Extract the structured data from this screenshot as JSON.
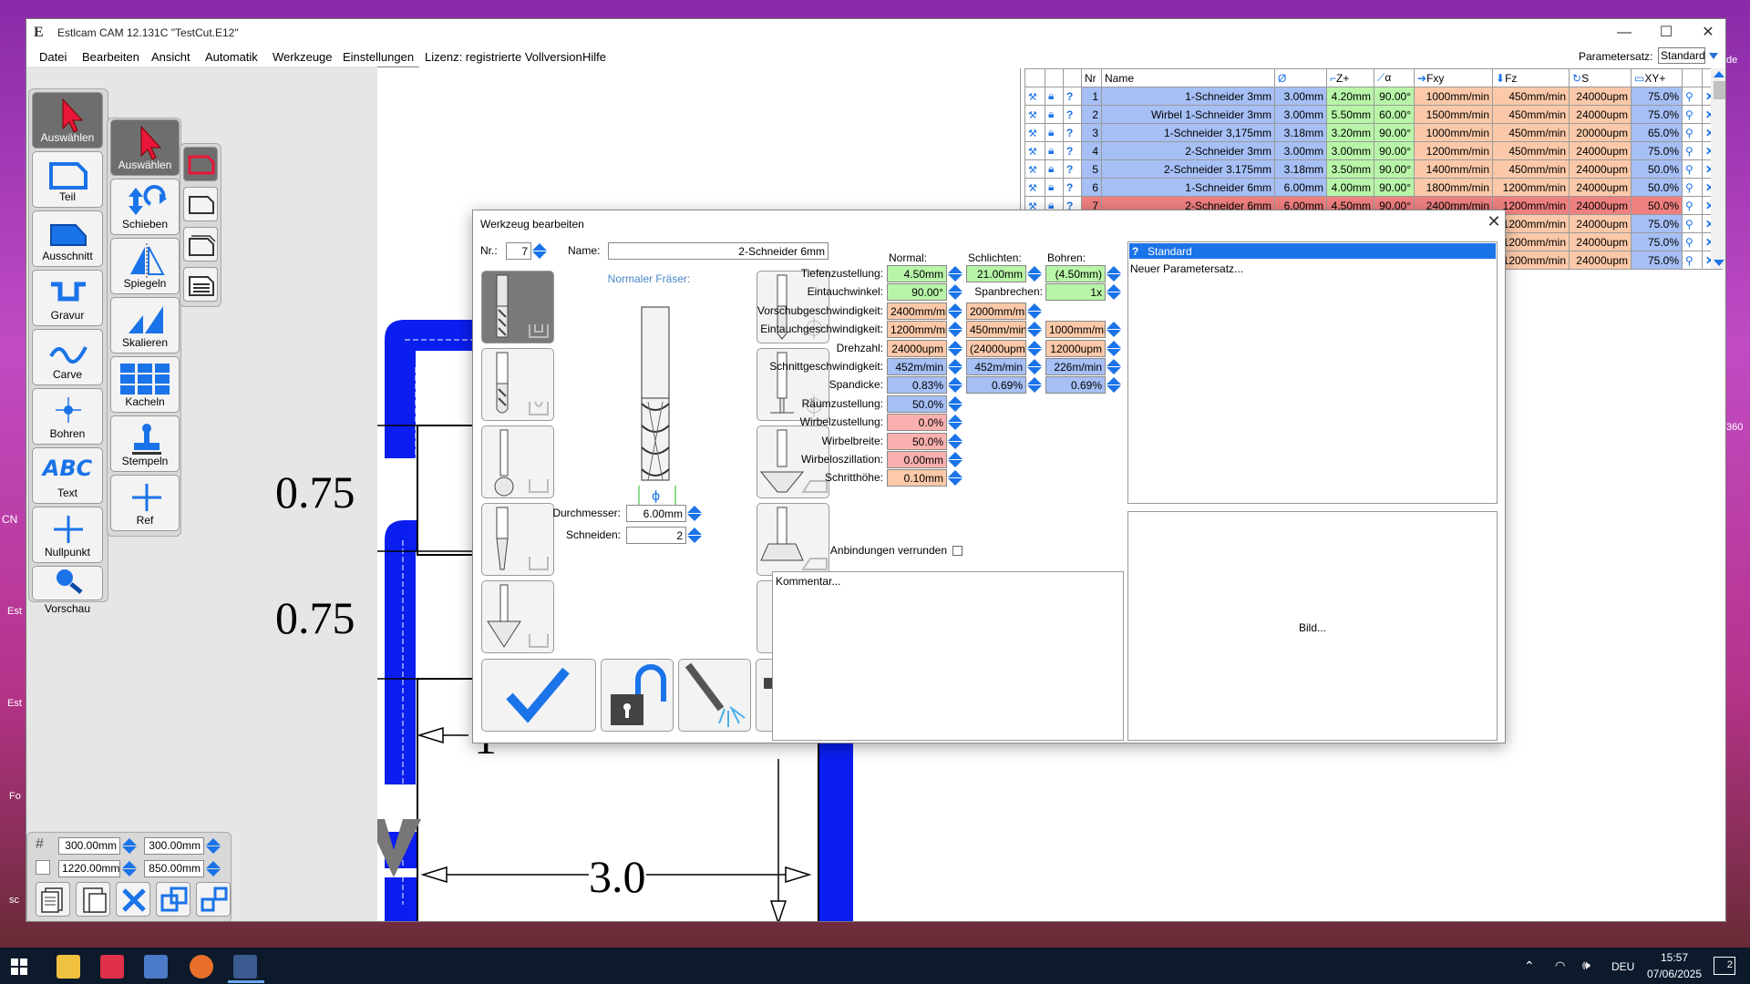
{
  "window": {
    "title": "Estlcam CAM 12.131C \"TestCut.E12\"",
    "minimize": "—",
    "maximize": "☐",
    "close": "✕"
  },
  "menu": [
    "Datei",
    "Bearbeiten",
    "Ansicht",
    "Automatik",
    "Werkzeuge",
    "Einstellungen",
    "Lizenz: registrierte Vollversion",
    "Hilfe"
  ],
  "paramset": {
    "label": "Parametersatz:",
    "value": "Standard"
  },
  "tools_left": [
    {
      "label": "Auswählen",
      "icon": "cursor-icon"
    },
    {
      "label": "Teil",
      "icon": "part-icon"
    },
    {
      "label": "Ausschnitt",
      "icon": "cutout-icon"
    },
    {
      "label": "Gravur",
      "icon": "engrave-icon"
    },
    {
      "label": "Carve",
      "icon": "carve-icon"
    },
    {
      "label": "Bohren",
      "icon": "drill-icon"
    },
    {
      "label": "Text",
      "icon": "text-icon",
      "glyph": "ABC"
    },
    {
      "label": "Nullpunkt",
      "icon": "origin-icon"
    },
    {
      "label": "Vorschau",
      "icon": "preview-icon"
    }
  ],
  "tools_mid": [
    {
      "label": "Auswählen",
      "icon": "cursor-icon"
    },
    {
      "label": "Schieben",
      "icon": "move-icon"
    },
    {
      "label": "Spiegeln",
      "icon": "mirror-icon"
    },
    {
      "label": "Skalieren",
      "icon": "scale-icon"
    },
    {
      "label": "Kacheln",
      "icon": "tile-icon"
    },
    {
      "label": "Stempeln",
      "icon": "stamp-icon"
    },
    {
      "label": "Ref",
      "icon": "ref-icon"
    }
  ],
  "size_fields": {
    "w1": "300.00mm",
    "h1": "300.00mm",
    "w2": "1220.00mm",
    "h2": "850.00mm"
  },
  "drawing": {
    "dim1": "0.75",
    "dim2": "0.75",
    "dim3": "3.0",
    "dim4": "1"
  },
  "tooltable": {
    "headers": [
      "Nr",
      "Name",
      "Ø",
      "Z+",
      "α",
      "Fxy",
      "Fz",
      "S",
      "XY+"
    ],
    "rows": [
      {
        "nr": "1",
        "name": "1-Schneider 3mm",
        "d": "3.00mm",
        "z": "4.20mm",
        "a": "90.00°",
        "fxy": "1000mm/min",
        "fz": "450mm/min",
        "s": "24000upm",
        "xy": "75.0%"
      },
      {
        "nr": "2",
        "name": "Wirbel 1-Schneider 3mm",
        "d": "3.00mm",
        "z": "5.50mm",
        "a": "60.00°",
        "fxy": "1500mm/min",
        "fz": "450mm/min",
        "s": "24000upm",
        "xy": "75.0%"
      },
      {
        "nr": "3",
        "name": "1-Schneider 3,175mm",
        "d": "3.18mm",
        "z": "3.20mm",
        "a": "90.00°",
        "fxy": "1000mm/min",
        "fz": "450mm/min",
        "s": "20000upm",
        "xy": "65.0%"
      },
      {
        "nr": "4",
        "name": "2-Schneider 3mm",
        "d": "3.00mm",
        "z": "3.00mm",
        "a": "90.00°",
        "fxy": "1200mm/min",
        "fz": "450mm/min",
        "s": "24000upm",
        "xy": "75.0%"
      },
      {
        "nr": "5",
        "name": "2-Schneider 3.175mm",
        "d": "3.18mm",
        "z": "3.50mm",
        "a": "90.00°",
        "fxy": "1400mm/min",
        "fz": "450mm/min",
        "s": "24000upm",
        "xy": "50.0%"
      },
      {
        "nr": "6",
        "name": "1-Schneider 6mm",
        "d": "6.00mm",
        "z": "4.00mm",
        "a": "90.00°",
        "fxy": "1800mm/min",
        "fz": "1200mm/min",
        "s": "24000upm",
        "xy": "50.0%"
      },
      {
        "nr": "7",
        "name": "2-Schneider 6mm",
        "d": "6.00mm",
        "z": "4.50mm",
        "a": "90.00°",
        "fxy": "2400mm/min",
        "fz": "1200mm/min",
        "s": "24000upm",
        "xy": "50.0%"
      },
      {
        "nr": "",
        "name": "",
        "d": "",
        "z": "",
        "a": "",
        "fxy": "",
        "fz": "1200mm/min",
        "s": "24000upm",
        "xy": "75.0%"
      },
      {
        "nr": "",
        "name": "",
        "d": "",
        "z": "",
        "a": "",
        "fxy": "",
        "fz": "1200mm/min",
        "s": "24000upm",
        "xy": "75.0%"
      },
      {
        "nr": "",
        "name": "",
        "d": "",
        "z": "",
        "a": "",
        "fxy": "",
        "fz": "1200mm/min",
        "s": "24000upm",
        "xy": "75.0%"
      }
    ]
  },
  "dialog": {
    "title": "Werkzeug bearbeiten",
    "nr_label": "Nr.:",
    "nr_value": "7",
    "name_label": "Name:",
    "name_value": "2-Schneider 6mm",
    "type_label": "Normaler Fräser:",
    "durchmesser_label": "Durchmesser:",
    "durchmesser_value": "6.00mm",
    "schneiden_label": "Schneiden:",
    "schneiden_value": "2",
    "col_normal": "Normal:",
    "col_schlichten": "Schlichten:",
    "col_bohren": "Bohren:",
    "params": [
      {
        "label": "Tiefenzustellung:",
        "normal": "4.50mm",
        "schlichten": "21.00mm",
        "bohren": "(4.50mm)"
      },
      {
        "label": "Eintauchwinkel:",
        "normal": "90.00°",
        "schlichten_label": "Spanbrechen:",
        "bohren": "1x"
      },
      {
        "label": "Vorschubgeschwindigkeit:",
        "normal": "2400mm/min",
        "schlichten": "2000mm/min"
      },
      {
        "label": "Eintauchgeschwindigkeit:",
        "normal": "1200mm/min",
        "schlichten": "450mm/min",
        "bohren": "1000mm/min"
      },
      {
        "label": "Drehzahl:",
        "normal": "24000upm",
        "schlichten": "(24000upm)",
        "bohren": "12000upm"
      },
      {
        "label": "Schnittgeschwindigkeit:",
        "normal": "452m/min",
        "schlichten": "452m/min",
        "bohren": "226m/min"
      },
      {
        "label": "Spandicke:",
        "normal": "0.83%",
        "schlichten": "0.69%",
        "bohren": "0.69%"
      },
      {
        "label": "Räumzustellung:",
        "normal": "50.0%"
      },
      {
        "label": "Wirbelzustellung:",
        "normal": "0.0%"
      },
      {
        "label": "Wirbelbreite:",
        "normal": "50.0%"
      },
      {
        "label": "Wirbeloszillation:",
        "normal": "0.00mm"
      },
      {
        "label": "Schritthöhe:",
        "normal": "0.10mm"
      }
    ],
    "anbindungen_label": "Anbindungen verrunden",
    "kommentar": "Kommentar...",
    "paramsets": [
      "Standard",
      "Neuer Parametersatz..."
    ],
    "bild": "Bild..."
  },
  "taskbar": {
    "lang": "DEU",
    "time": "15:57",
    "date": "07/06/2025",
    "notif": "2"
  },
  "desktop": {
    "partial1": "CN",
    "partial2": "Est",
    "partial3": "Est",
    "partial4": "Fo",
    "partial5": "sc",
    "partial6": "360",
    "partial7": "de"
  }
}
